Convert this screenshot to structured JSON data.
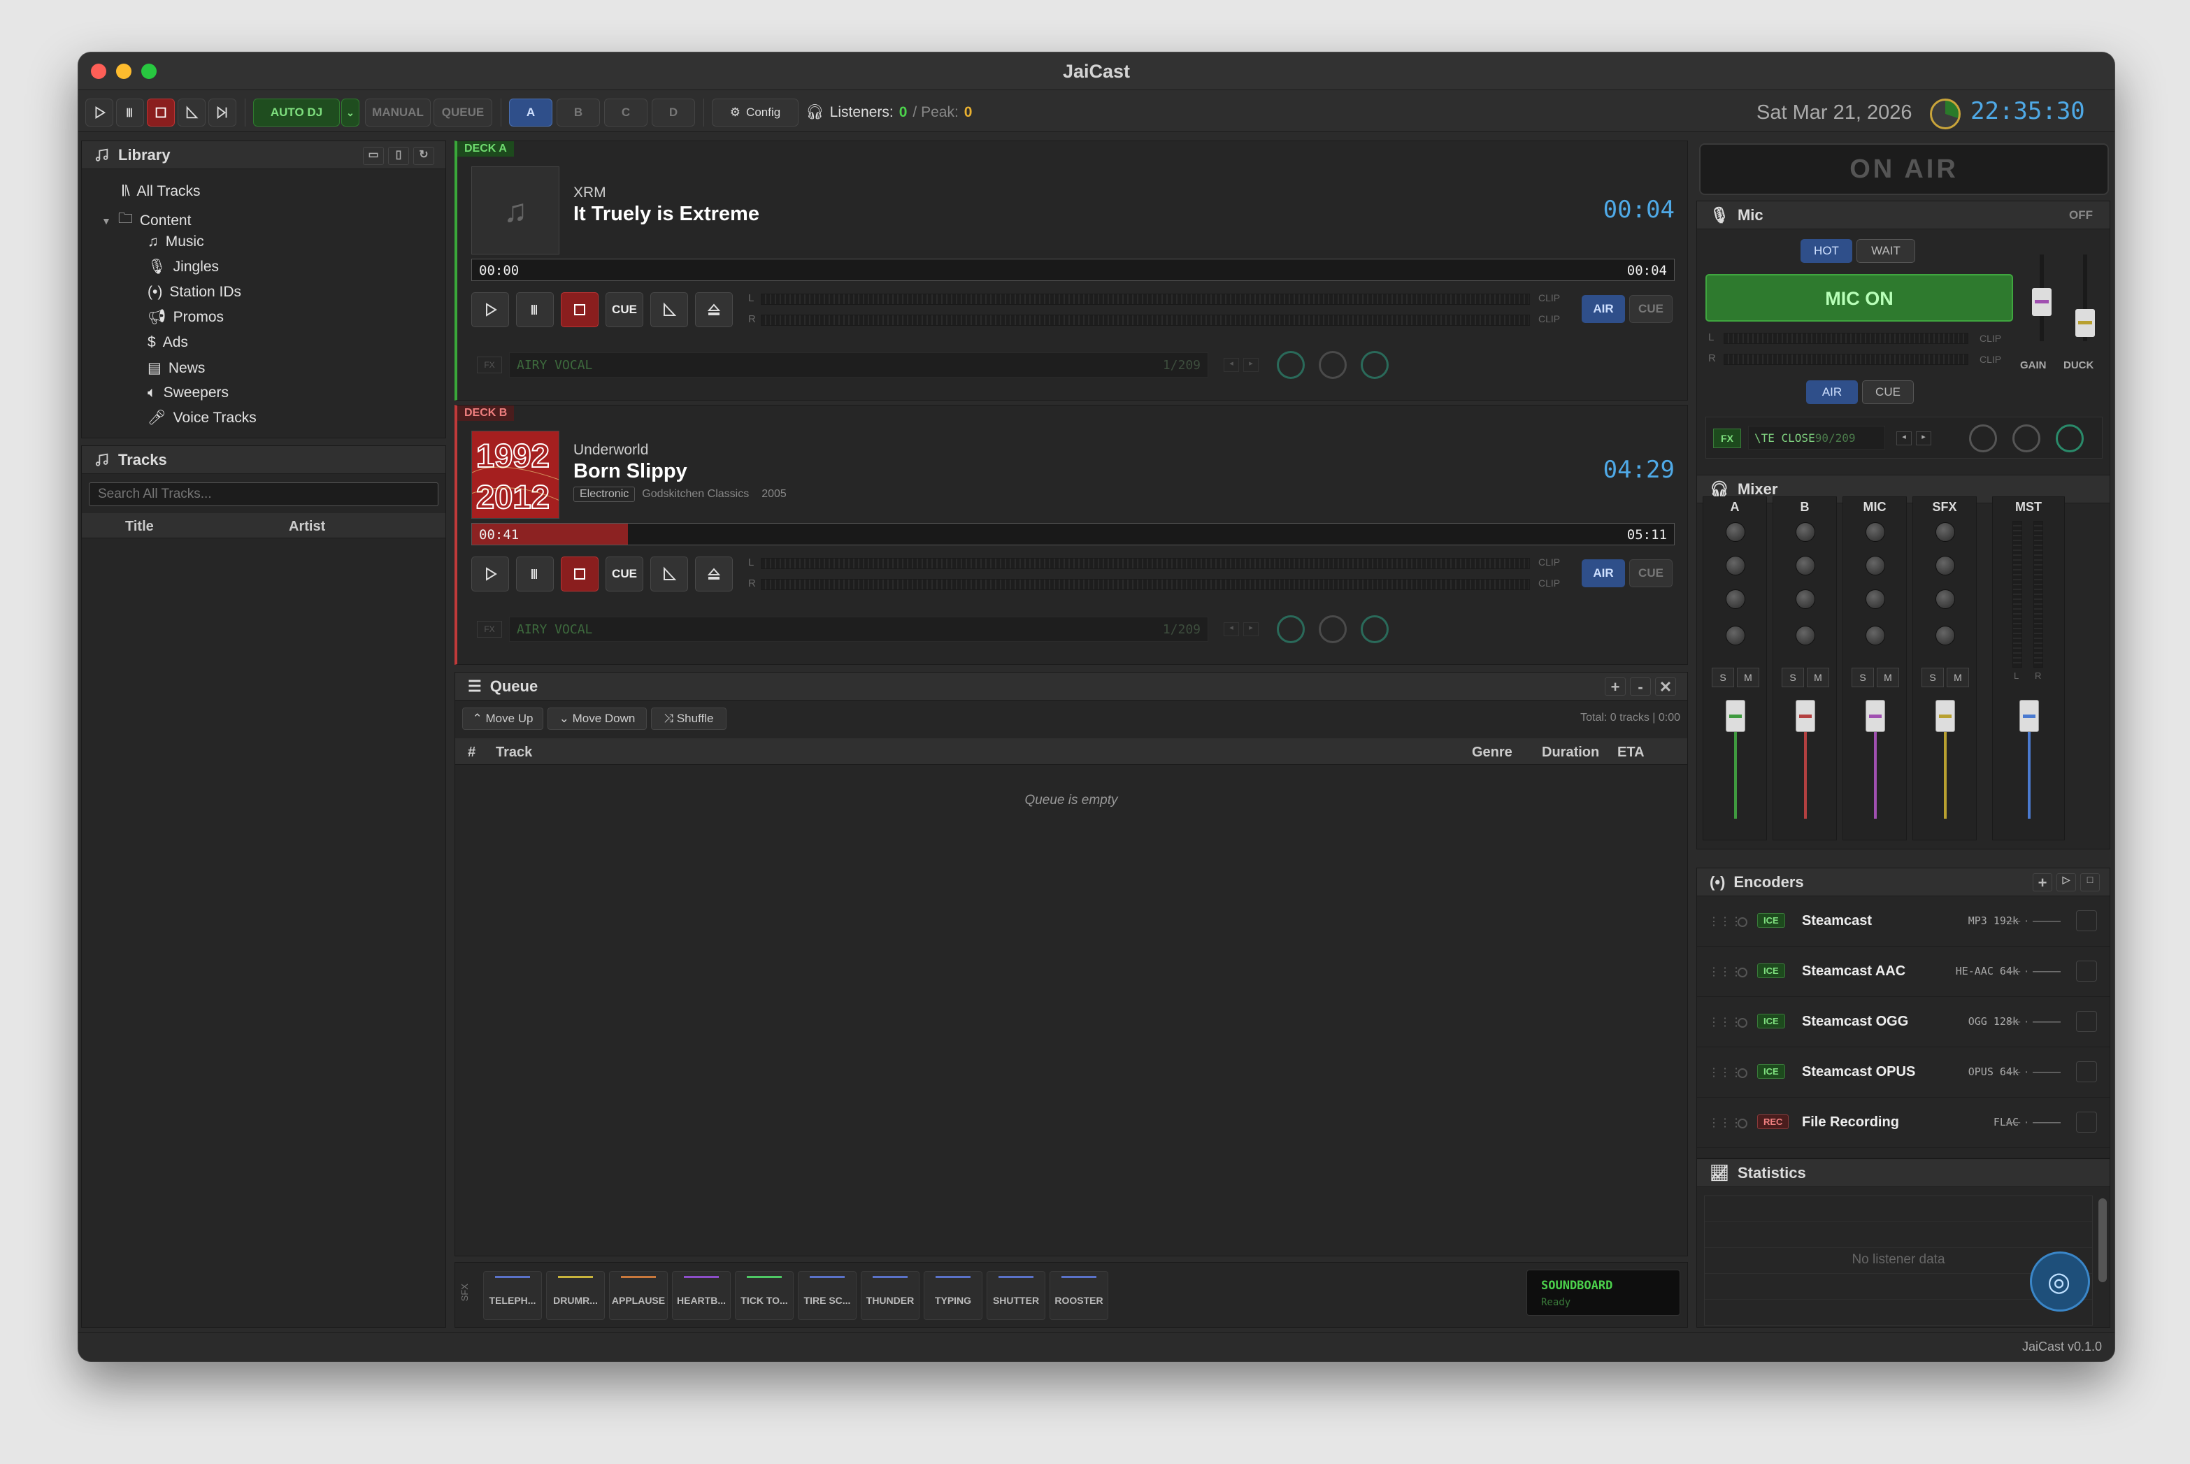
{
  "window": {
    "title": "JaiCast",
    "version": "JaiCast v0.1.0"
  },
  "toolbar": {
    "auto_dj": "AUTO DJ",
    "manual": "MANUAL",
    "queue": "QUEUE",
    "decks": [
      "A",
      "B",
      "C",
      "D"
    ],
    "config": "Config",
    "listeners_label": "Listeners:",
    "listeners": "0",
    "peak_label": "/ Peak:",
    "peak": "0",
    "date": "Sat Mar 21, 2026",
    "clock": "22:35:30"
  },
  "library": {
    "title": "Library",
    "items": [
      "All Tracks",
      "Content",
      "Music",
      "Jingles",
      "Station IDs",
      "Promos",
      "Ads",
      "News",
      "Sweepers",
      "Voice Tracks"
    ]
  },
  "tracks": {
    "title": "Tracks",
    "search_placeholder": "Search All Tracks...",
    "col_title": "Title",
    "col_artist": "Artist"
  },
  "deck_a": {
    "tag": "DECK A",
    "artist": "XRM",
    "title": "It Truely is Extreme",
    "remaining": "00:04",
    "elapsed": "00:00",
    "duration": "00:04",
    "progress": 0.0,
    "cue": "CUE",
    "air": "AIR",
    "cue2": "CUE",
    "clip": "CLIP",
    "fx": "FX",
    "preset": "AIRY VOCAL",
    "preset_count": "1/209",
    "L": "L",
    "R": "R"
  },
  "deck_b": {
    "tag": "DECK B",
    "artist": "Underworld",
    "title": "Born Slippy",
    "genre": "Electronic",
    "album": "Godskitchen Classics",
    "year": "2005",
    "remaining": "04:29",
    "elapsed": "00:41",
    "duration": "05:11",
    "progress": 0.13,
    "cue": "CUE",
    "air": "AIR",
    "cue2": "CUE",
    "clip": "CLIP",
    "fx": "FX",
    "preset": "AIRY VOCAL",
    "preset_count": "1/209",
    "L": "L",
    "R": "R"
  },
  "queue": {
    "title": "Queue",
    "move_up": "Move Up",
    "move_down": "Move Down",
    "shuffle": "Shuffle",
    "total": "Total: 0 tracks | 0:00",
    "col_num": "#",
    "col_track": "Track",
    "col_genre": "Genre",
    "col_duration": "Duration",
    "col_eta": "ETA",
    "empty": "Queue is empty"
  },
  "sfx": {
    "label": "SFX",
    "pads": [
      {
        "name": "TELEPH...",
        "color": "#5a72c8"
      },
      {
        "name": "DRUMR...",
        "color": "#c8b43c"
      },
      {
        "name": "APPLAUSE",
        "color": "#c8783c"
      },
      {
        "name": "HEARTB...",
        "color": "#8c4ec8"
      },
      {
        "name": "TICK TO...",
        "color": "#4ec864"
      },
      {
        "name": "TIRE SC...",
        "color": "#5a72c8"
      },
      {
        "name": "THUNDER",
        "color": "#5a72c8"
      },
      {
        "name": "TYPING",
        "color": "#5a72c8"
      },
      {
        "name": "SHUTTER",
        "color": "#5a72c8"
      },
      {
        "name": "ROOSTER",
        "color": "#5a72c8"
      }
    ],
    "soundboard": "SOUNDBOARD",
    "soundboard_status": "Ready"
  },
  "onair": "ON AIR",
  "mic": {
    "title": "Mic",
    "state": "OFF",
    "hot": "HOT",
    "wait": "WAIT",
    "mic_on": "MIC ON",
    "clip": "CLIP",
    "air": "AIR",
    "cue": "CUE",
    "gain": "GAIN",
    "duck": "DUCK",
    "fx": "FX",
    "preset": "\\TE CLOSE",
    "preset_count": "90/209",
    "L": "L",
    "R": "R"
  },
  "mixer": {
    "title": "Mixer",
    "channels": [
      {
        "name": "A",
        "color": "#3f9a3f"
      },
      {
        "name": "B",
        "color": "#b34040"
      },
      {
        "name": "MIC",
        "color": "#a050b0"
      },
      {
        "name": "SFX",
        "color": "#b8a030"
      },
      {
        "name": "MST",
        "color": "#4a7ad0"
      }
    ],
    "solo": "S",
    "mute": "M",
    "L": "L",
    "R": "R"
  },
  "encoders": {
    "title": "Encoders",
    "items": [
      {
        "badge": "ICE",
        "name": "Steamcast",
        "format": "MP3 192k",
        "status": "— · ——"
      },
      {
        "badge": "ICE",
        "name": "Steamcast AAC",
        "format": "HE-AAC 64k",
        "status": "— · ——"
      },
      {
        "badge": "ICE",
        "name": "Steamcast OGG",
        "format": "OGG 128k",
        "status": "— · ——"
      },
      {
        "badge": "ICE",
        "name": "Steamcast OPUS",
        "format": "OPUS 64k",
        "status": "— · ——"
      },
      {
        "badge": "REC",
        "name": "File Recording",
        "format": "FLAC",
        "status": "— · ——"
      }
    ]
  },
  "statistics": {
    "title": "Statistics",
    "empty": "No listener data"
  },
  "colors": {
    "accent_green": "#2e8b2e",
    "accent_blue": "#4fa9e6",
    "deck_a": "#3aa83a",
    "deck_b": "#c03a3a"
  }
}
